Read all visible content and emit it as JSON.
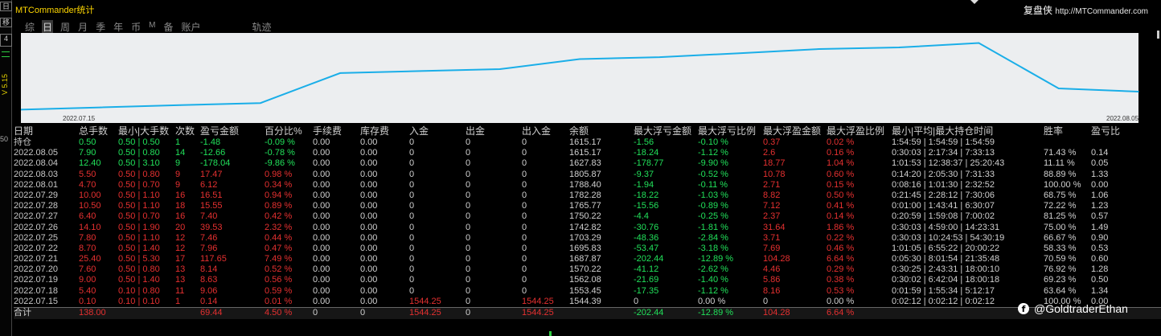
{
  "app_title": "MTCommander统计",
  "brand": {
    "name": "复盘侠",
    "url": "http://MTCommander.com"
  },
  "left_strip": {
    "items": [
      "日",
      "移",
      "4",
      "V 5.15"
    ],
    "axis_mark": "50"
  },
  "tabs": [
    {
      "label": "综",
      "active": false
    },
    {
      "label": "日",
      "active": true
    },
    {
      "label": "周",
      "active": false
    },
    {
      "label": "月",
      "active": false
    },
    {
      "label": "季",
      "active": false
    },
    {
      "label": "年",
      "active": false
    },
    {
      "label": "币",
      "active": false
    },
    {
      "label": "M",
      "active": false
    },
    {
      "label": "备",
      "active": false
    },
    {
      "label": "账户",
      "active": false
    },
    {
      "label": "轨迹",
      "active": false
    }
  ],
  "chart_data": {
    "type": "line",
    "x": [
      "2022.07.15",
      "2022.07.18",
      "2022.07.19",
      "2022.07.20",
      "2022.07.21",
      "2022.07.22",
      "2022.07.25",
      "2022.07.26",
      "2022.07.27",
      "2022.07.28",
      "2022.07.29",
      "2022.08.01",
      "2022.08.03",
      "2022.08.04",
      "2022.08.05"
    ],
    "values": [
      1544.39,
      1553.45,
      1562.08,
      1570.22,
      1687.87,
      1695.83,
      1703.29,
      1742.82,
      1750.22,
      1765.77,
      1782.28,
      1788.4,
      1805.87,
      1627.83,
      1615.17
    ],
    "start_label": "2022.07.15",
    "end_label": "2022.08.05",
    "ylim": [
      1530,
      1820
    ],
    "line_color": "#1aaee8",
    "background": "#eceef0"
  },
  "table": {
    "columns": [
      "日期",
      "总手数",
      "最小|大手数",
      "次数",
      "盈亏金额",
      "百分比%",
      "手续费",
      "库存费",
      "入金",
      "出金",
      "出入金",
      "余额",
      "最大浮亏金额",
      "最大浮亏比例",
      "最大浮盈金额",
      "最大浮盈比例",
      "最小|平均|最大持仓时间",
      "胜率",
      "盈亏比"
    ],
    "holding": [
      "持仓",
      "0.50",
      "0.50 | 0.50",
      "1",
      "-1.48",
      "-0.09 %",
      "0.00",
      "0.00",
      "0",
      "0",
      "0",
      "1615.17",
      "-1.56",
      "-0.10 %",
      "0.37",
      "0.02 %",
      "1:54:59 | 1:54:59 | 1:54:59",
      "",
      ""
    ],
    "rows": [
      [
        "2022.08.05",
        "7.90",
        "0.50 | 0.80",
        "14",
        "-12.66",
        "-0.78 %",
        "0.00",
        "0.00",
        "0",
        "0",
        "0",
        "1615.17",
        "-18.24",
        "-1.12 %",
        "2.6",
        "0.16 %",
        "0:30:03 | 2:17:34 | 7:33:13",
        "71.43 %",
        "0.14"
      ],
      [
        "2022.08.04",
        "12.40",
        "0.50 | 3.10",
        "9",
        "-178.04",
        "-9.86 %",
        "0.00",
        "0.00",
        "0",
        "0",
        "0",
        "1627.83",
        "-178.77",
        "-9.90 %",
        "18.77",
        "1.04 %",
        "1:01:53 | 12:38:37 | 25:20:43",
        "11.11 %",
        "0.05"
      ],
      [
        "2022.08.03",
        "5.50",
        "0.50 | 0.80",
        "9",
        "17.47",
        "0.98 %",
        "0.00",
        "0.00",
        "0",
        "0",
        "0",
        "1805.87",
        "-9.37",
        "-0.52 %",
        "10.78",
        "0.60 %",
        "0:14:20 | 2:05:30 | 7:31:33",
        "88.89 %",
        "1.33"
      ],
      [
        "2022.08.01",
        "4.70",
        "0.50 | 0.70",
        "9",
        "6.12",
        "0.34 %",
        "0.00",
        "0.00",
        "0",
        "0",
        "0",
        "1788.40",
        "-1.94",
        "-0.11 %",
        "2.71",
        "0.15 %",
        "0:08:16 | 1:01:30 | 2:32:52",
        "100.00 %",
        "0.00"
      ],
      [
        "2022.07.29",
        "10.00",
        "0.50 | 1.10",
        "16",
        "16.51",
        "0.94 %",
        "0.00",
        "0.00",
        "0",
        "0",
        "0",
        "1782.28",
        "-18.22",
        "-1.03 %",
        "8.82",
        "0.50 %",
        "0:21:45 | 2:28:12 | 7:30:06",
        "68.75 %",
        "1.06"
      ],
      [
        "2022.07.28",
        "10.50",
        "0.50 | 1.10",
        "18",
        "15.55",
        "0.89 %",
        "0.00",
        "0.00",
        "0",
        "0",
        "0",
        "1765.77",
        "-15.56",
        "-0.89 %",
        "7.12",
        "0.41 %",
        "0:01:00 | 1:43:41 | 6:30:07",
        "72.22 %",
        "1.23"
      ],
      [
        "2022.07.27",
        "6.40",
        "0.50 | 0.70",
        "16",
        "7.40",
        "0.42 %",
        "0.00",
        "0.00",
        "0",
        "0",
        "0",
        "1750.22",
        "-4.4",
        "-0.25 %",
        "2.37",
        "0.14 %",
        "0:20:59 | 1:59:08 | 7:00:02",
        "81.25 %",
        "0.57"
      ],
      [
        "2022.07.26",
        "14.10",
        "0.50 | 1.90",
        "20",
        "39.53",
        "2.32 %",
        "0.00",
        "0.00",
        "0",
        "0",
        "0",
        "1742.82",
        "-30.76",
        "-1.81 %",
        "31.64",
        "1.86 %",
        "0:30:03 | 4:59:00 | 14:23:31",
        "75.00 %",
        "1.49"
      ],
      [
        "2022.07.25",
        "7.80",
        "0.50 | 1.10",
        "12",
        "7.46",
        "0.44 %",
        "0.00",
        "0.00",
        "0",
        "0",
        "0",
        "1703.29",
        "-48.36",
        "-2.84 %",
        "3.71",
        "0.22 %",
        "0:30:03 | 10:24:53 | 54:30:19",
        "66.67 %",
        "0.90"
      ],
      [
        "2022.07.22",
        "8.70",
        "0.50 | 1.40",
        "12",
        "7.96",
        "0.47 %",
        "0.00",
        "0.00",
        "0",
        "0",
        "0",
        "1695.83",
        "-53.47",
        "-3.18 %",
        "7.69",
        "0.46 %",
        "1:01:05 | 6:55:22 | 20:00:22",
        "58.33 %",
        "0.53"
      ],
      [
        "2022.07.21",
        "25.40",
        "0.50 | 5.30",
        "17",
        "117.65",
        "7.49 %",
        "0.00",
        "0.00",
        "0",
        "0",
        "0",
        "1687.87",
        "-202.44",
        "-12.89 %",
        "104.28",
        "6.64 %",
        "0:05:30 | 8:01:54 | 21:35:48",
        "70.59 %",
        "0.60"
      ],
      [
        "2022.07.20",
        "7.60",
        "0.50 | 0.80",
        "13",
        "8.14",
        "0.52 %",
        "0.00",
        "0.00",
        "0",
        "0",
        "0",
        "1570.22",
        "-41.12",
        "-2.62 %",
        "4.46",
        "0.29 %",
        "0:30:25 | 2:43:31 | 18:00:10",
        "76.92 %",
        "1.28"
      ],
      [
        "2022.07.19",
        "9.00",
        "0.50 | 1.40",
        "13",
        "8.63",
        "0.56 %",
        "0.00",
        "0.00",
        "0",
        "0",
        "0",
        "1562.08",
        "-21.69",
        "-1.40 %",
        "5.86",
        "0.38 %",
        "0:30:02 | 6:42:04 | 18:00:18",
        "69.23 %",
        "0.50"
      ],
      [
        "2022.07.18",
        "5.40",
        "0.10 | 0.80",
        "11",
        "9.06",
        "0.59 %",
        "0.00",
        "0.00",
        "0",
        "0",
        "0",
        "1553.45",
        "-17.35",
        "-1.12 %",
        "8.16",
        "0.53 %",
        "0:01:59 | 1:55:34 | 5:12:17",
        "63.64 %",
        "1.34"
      ],
      [
        "2022.07.15",
        "0.10",
        "0.10 | 0.10",
        "1",
        "0.14",
        "0.01 %",
        "0.00",
        "0.00",
        "1544.25",
        "0",
        "1544.25",
        "1544.39",
        "0",
        "0.00 %",
        "0",
        "0.00 %",
        "0:02:12 | 0:02:12 | 0:02:12",
        "100.00 %",
        "0.00"
      ]
    ],
    "total": [
      "合计",
      "138.00",
      "",
      "",
      "69.44",
      "4.50 %",
      "0",
      "0",
      "1544.25",
      "0",
      "1544.25",
      "",
      "-202.44",
      "-12.89 %",
      "104.28",
      "6.64 %",
      "",
      "",
      ""
    ]
  },
  "watermark": "@GoldtraderEthan",
  "colors": {
    "positive": "#e53030",
    "negative": "#21e05a",
    "title": "#ffd700",
    "line": "#1aaee8"
  }
}
